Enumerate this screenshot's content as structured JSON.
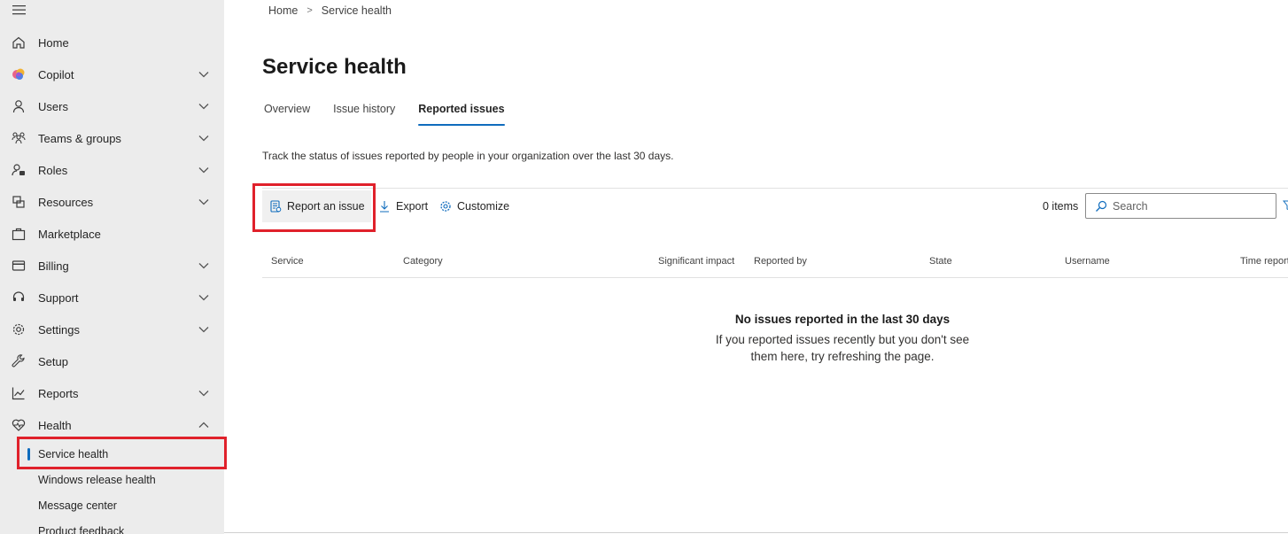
{
  "sidebar": {
    "items": [
      {
        "label": "Home",
        "icon": "home-icon",
        "chevron": false
      },
      {
        "label": "Copilot",
        "icon": "copilot-icon",
        "chevron": true
      },
      {
        "label": "Users",
        "icon": "user-icon",
        "chevron": true
      },
      {
        "label": "Teams & groups",
        "icon": "teams-groups-icon",
        "chevron": true
      },
      {
        "label": "Roles",
        "icon": "roles-icon",
        "chevron": true
      },
      {
        "label": "Resources",
        "icon": "resources-icon",
        "chevron": true
      },
      {
        "label": "Marketplace",
        "icon": "marketplace-icon",
        "chevron": false
      },
      {
        "label": "Billing",
        "icon": "billing-icon",
        "chevron": true
      },
      {
        "label": "Support",
        "icon": "support-icon",
        "chevron": true
      },
      {
        "label": "Settings",
        "icon": "gear-icon",
        "chevron": true
      },
      {
        "label": "Setup",
        "icon": "wrench-icon",
        "chevron": false
      },
      {
        "label": "Reports",
        "icon": "chart-icon",
        "chevron": true
      },
      {
        "label": "Health",
        "icon": "heart-icon",
        "chevron": true,
        "expanded": true
      }
    ],
    "health_sub_items": [
      {
        "label": "Service health",
        "active": true
      },
      {
        "label": "Windows release health"
      },
      {
        "label": "Message center"
      },
      {
        "label": "Product feedback"
      }
    ]
  },
  "breadcrumb": {
    "home": "Home",
    "separator": ">",
    "current": "Service health"
  },
  "page": {
    "title": "Service health",
    "tabs": [
      {
        "label": "Overview"
      },
      {
        "label": "Issue history"
      },
      {
        "label": "Reported issues",
        "active": true
      }
    ],
    "description": "Track the status of issues reported by people in your organization over the last 30 days."
  },
  "toolbar": {
    "report_label": "Report an issue",
    "export_label": "Export",
    "customize_label": "Customize",
    "items_count": "0 items",
    "search_placeholder": "Search"
  },
  "table": {
    "columns": [
      "Service",
      "Category",
      "Significant impact",
      "Reported by",
      "State",
      "Username",
      "Time reported"
    ]
  },
  "empty_state": {
    "title": "No issues reported in the last 30 days",
    "text": "If you reported issues recently but you don't see them here, try refreshing the page."
  },
  "colors": {
    "accent": "#0f6cbd",
    "highlight": "#e0212b",
    "sidebar_bg": "#ececec"
  }
}
